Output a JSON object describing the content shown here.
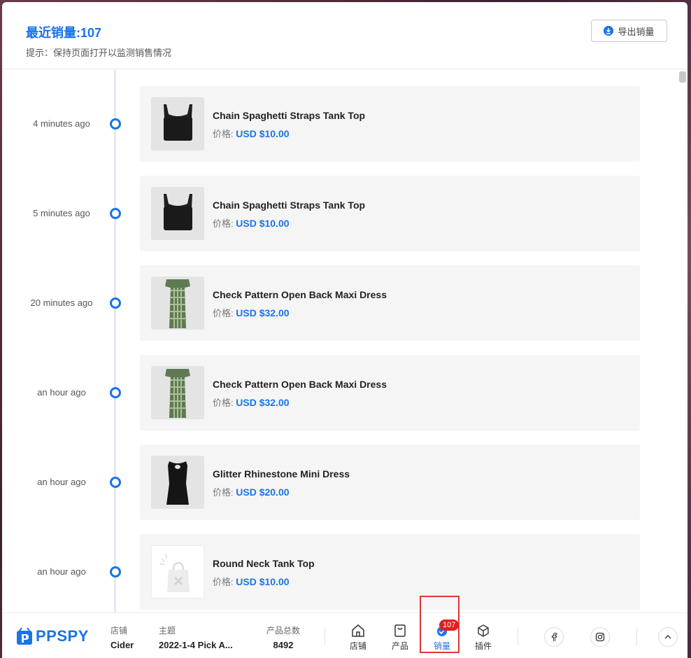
{
  "header": {
    "title": "最近销量:107",
    "hint": "提示：保持页面打开以监测销售情况",
    "export_label": "导出销量"
  },
  "price_prefix": "价格:",
  "sales": [
    {
      "time": "4 minutes ago",
      "name": "Chain Spaghetti Straps Tank Top",
      "price": "USD $10.00",
      "image": "black-tank-top"
    },
    {
      "time": "5 minutes ago",
      "name": "Chain Spaghetti Straps Tank Top",
      "price": "USD $10.00",
      "image": "black-tank-top"
    },
    {
      "time": "20 minutes ago",
      "name": "Check Pattern Open Back Maxi Dress",
      "price": "USD $32.00",
      "image": "green-check-dress"
    },
    {
      "time": "an hour ago",
      "name": "Check Pattern Open Back Maxi Dress",
      "price": "USD $32.00",
      "image": "green-check-dress"
    },
    {
      "time": "an hour ago",
      "name": "Glitter Rhinestone Mini Dress",
      "price": "USD $20.00",
      "image": "black-mini-dress"
    },
    {
      "time": "an hour ago",
      "name": "Round Neck Tank Top",
      "price": "USD $10.00",
      "image": "placeholder-image"
    }
  ],
  "footer": {
    "logo_pp": "PP",
    "logo_spy": "SPY",
    "store_label": "店铺",
    "store_value": "Cider",
    "theme_label": "主题",
    "theme_value": "2022-1-4 Pick A...",
    "products_label": "产品总数",
    "products_value": "8492",
    "nav": [
      {
        "label": "店铺",
        "icon": "home-icon"
      },
      {
        "label": "产品",
        "icon": "bag-icon"
      },
      {
        "label": "销量",
        "icon": "sales-icon",
        "badge": "107",
        "active": true
      },
      {
        "label": "插件",
        "icon": "cube-icon"
      }
    ],
    "social": [
      "facebook-icon",
      "instagram-icon"
    ],
    "collapse_icon": "chevron-up-icon"
  },
  "colors": {
    "accent": "#1a73e8",
    "badge": "#e02020",
    "highlight": "#e03535"
  }
}
